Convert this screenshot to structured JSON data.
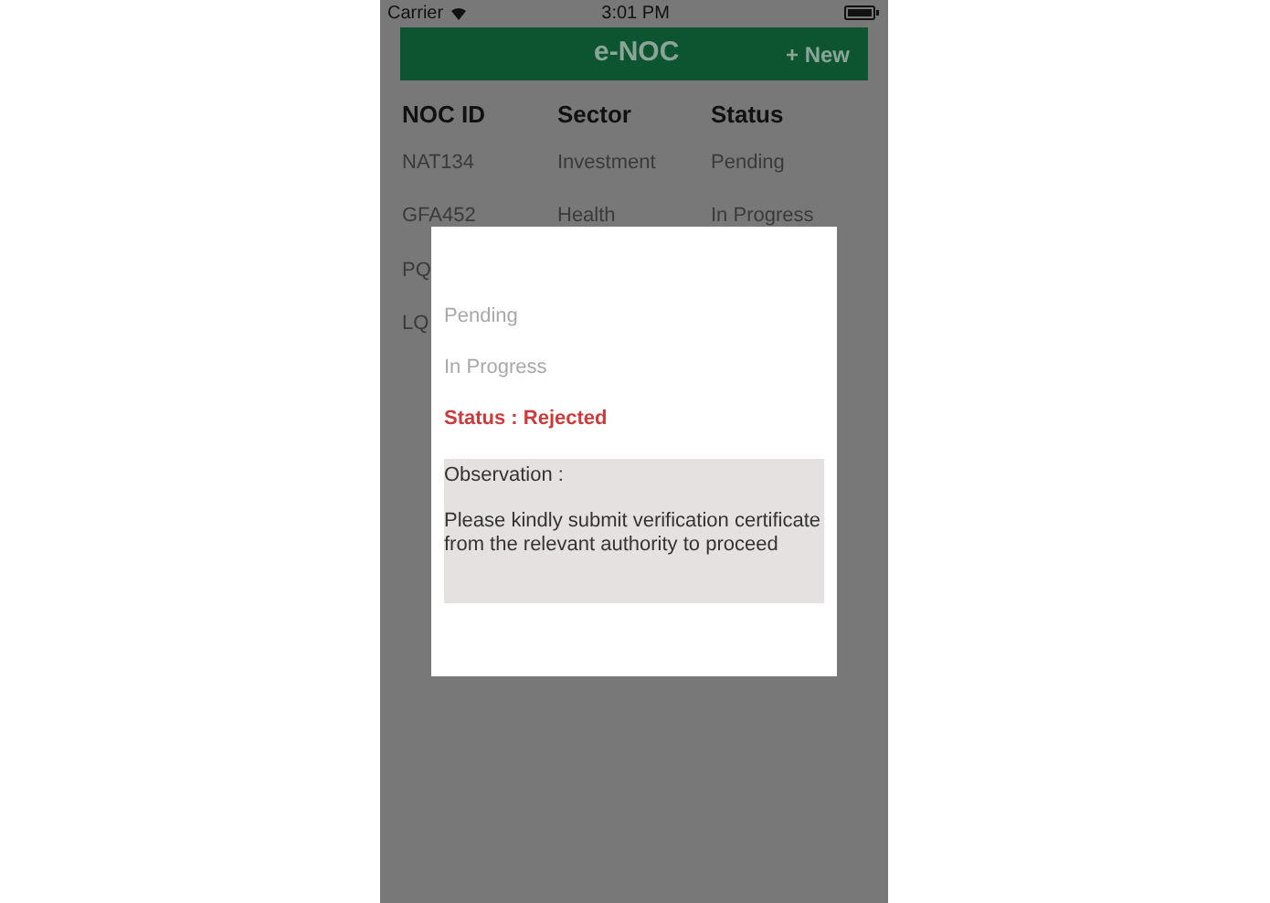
{
  "status_bar": {
    "carrier": "Carrier",
    "time": "3:01 PM"
  },
  "header": {
    "title": "e-NOC",
    "new_button": "+ New"
  },
  "table": {
    "columns": [
      "NOC ID",
      "Sector",
      "Status"
    ],
    "rows": [
      {
        "cells": [
          "NAT134",
          "Investment",
          "Pending"
        ]
      },
      {
        "cells": [
          "GFA452",
          "Health",
          "In Progress"
        ]
      },
      {
        "cells": [
          "PQ"
        ]
      },
      {
        "cells": [
          "LQ"
        ]
      }
    ]
  },
  "dialog": {
    "steps": [
      {
        "label": "Pending",
        "kind": "done"
      },
      {
        "label": "In Progress",
        "kind": "done"
      },
      {
        "label": "Status : Rejected",
        "kind": "current"
      }
    ],
    "observation": {
      "label": "Observation :",
      "text": "Please kindly submit verification certificate from the relevant authority to proceed"
    }
  }
}
